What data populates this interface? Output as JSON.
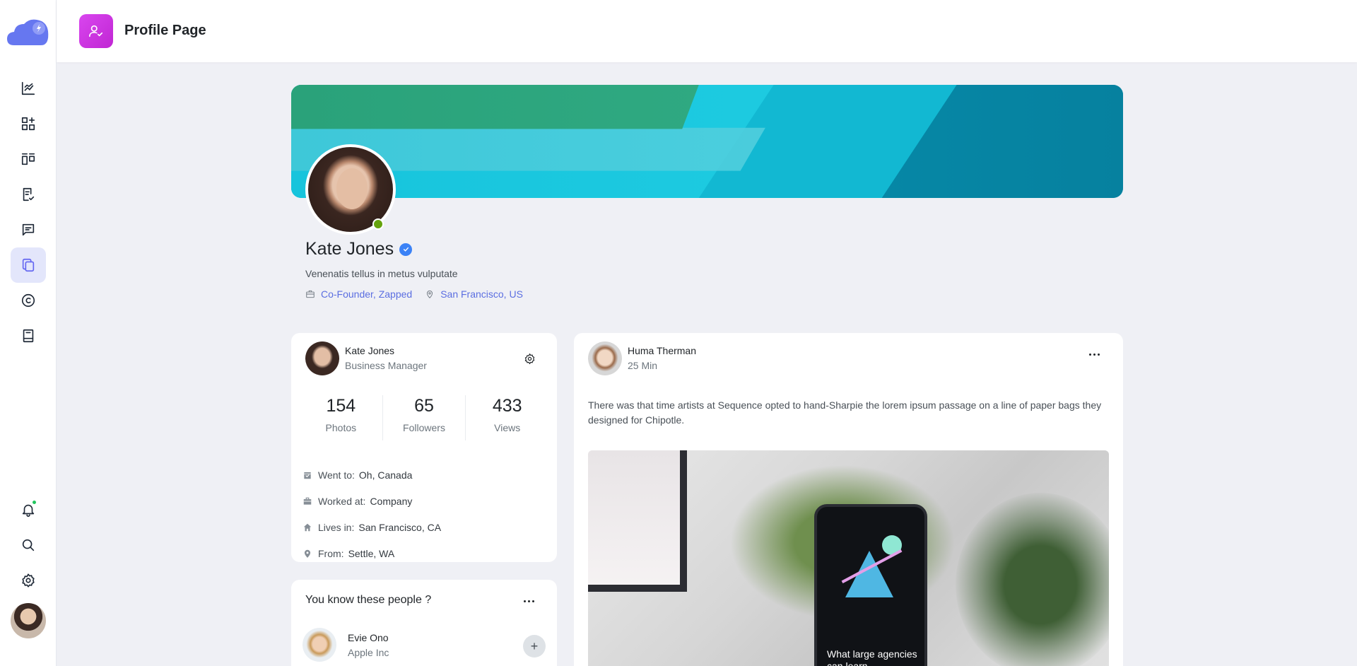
{
  "header": {
    "title": "Profile Page",
    "icon": "user-check-icon"
  },
  "sidebar": {
    "items": [
      {
        "name": "analytics",
        "icon": "chart-icon"
      },
      {
        "name": "apps",
        "icon": "grid-plus-icon"
      },
      {
        "name": "kanban",
        "icon": "columns-icon"
      },
      {
        "name": "tasks",
        "icon": "checklist-icon"
      },
      {
        "name": "chat",
        "icon": "message-icon"
      },
      {
        "name": "pages",
        "icon": "copy-icon",
        "active": true
      },
      {
        "name": "copyright",
        "icon": "copyright-icon"
      },
      {
        "name": "docs",
        "icon": "book-icon"
      }
    ],
    "bottom": [
      {
        "name": "notifications",
        "icon": "bell-icon",
        "has_badge": true
      },
      {
        "name": "search",
        "icon": "search-icon"
      },
      {
        "name": "settings",
        "icon": "gear-icon"
      }
    ]
  },
  "profile": {
    "name": "Kate Jones",
    "bio": "Venenatis tellus in metus vulputate",
    "role": "Co-Founder, Zapped",
    "location": "San Francisco, US"
  },
  "user_card": {
    "name": "Kate Jones",
    "title": "Business Manager",
    "stats": [
      {
        "value": "154",
        "label": "Photos"
      },
      {
        "value": "65",
        "label": "Followers"
      },
      {
        "value": "433",
        "label": "Views"
      }
    ],
    "info": [
      {
        "icon": "calendar-icon",
        "key": "Went to:",
        "value": "Oh, Canada"
      },
      {
        "icon": "briefcase-icon",
        "key": "Worked at:",
        "value": "Company"
      },
      {
        "icon": "home-icon",
        "key": "Lives in:",
        "value": "San Francisco, CA"
      },
      {
        "icon": "map-pin-icon",
        "key": "From:",
        "value": "Settle, WA"
      }
    ]
  },
  "people_card": {
    "title": "You know these people ?",
    "people": [
      {
        "name": "Evie Ono",
        "company": "Apple Inc"
      }
    ]
  },
  "post": {
    "author": "Huma Therman",
    "time": "25 Min",
    "text": "There was that time artists at Sequence opted to hand-Sharpie the lorem ipsum passage on a line of paper bags they designed for Chipotle.",
    "image_caption": "What large agencies can learn"
  },
  "colors": {
    "accent": "#6366f1",
    "header_icon": "#d946ef",
    "online": "#65a30d",
    "link": "#5b6ee1"
  }
}
